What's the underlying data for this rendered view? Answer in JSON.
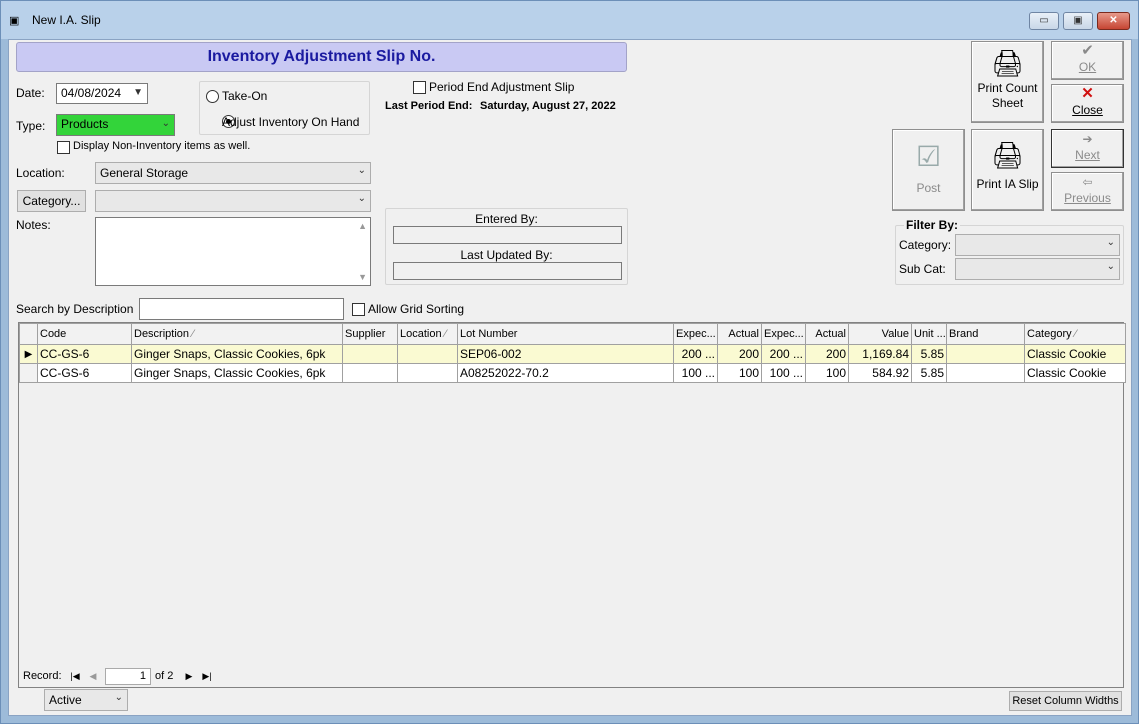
{
  "window": {
    "title": "New I.A. Slip",
    "min": "▭",
    "max": "▣",
    "close": "✕"
  },
  "header": {
    "title": "Inventory Adjustment Slip No."
  },
  "date": {
    "label": "Date:",
    "value": "04/08/2024"
  },
  "type": {
    "label": "Type:",
    "value": "Products",
    "color": "#33d43a"
  },
  "display_non_inventory": {
    "label": "Display Non-Inventory items as well."
  },
  "mode": {
    "take_on": "Take-On",
    "adjust": "Adjust Inventory On Hand",
    "selected": "adjust"
  },
  "period": {
    "checkbox_label": "Period End Adjustment Slip",
    "last_label": "Last Period End:",
    "last_value": "Saturday, August 27, 2022"
  },
  "location": {
    "label": "Location:",
    "value": "General Storage"
  },
  "category": {
    "button_label": "Category...",
    "value": ""
  },
  "notes": {
    "label": "Notes:",
    "value": ""
  },
  "audit": {
    "entered_label": "Entered By:",
    "entered_value": "",
    "updated_label": "Last Updated By:",
    "updated_value": ""
  },
  "buttons": {
    "print_count": "Print Count Sheet",
    "ok": "OK",
    "close": "Close",
    "post": "Post",
    "print_ia": "Print IA Slip",
    "next": "Next",
    "previous": "Previous"
  },
  "filter": {
    "title": "Filter By:",
    "category_label": "Category:",
    "subcat_label": "Sub Cat:"
  },
  "search": {
    "label": "Search by Description",
    "value": "",
    "allow_sorting": "Allow Grid Sorting"
  },
  "grid": {
    "columns": [
      "Code",
      "Description",
      "Supplier",
      "Location",
      "Lot Number",
      "Expec...",
      "Actual",
      "Expec...",
      "Actual",
      "Value",
      "Unit ...",
      "Brand",
      "Category"
    ],
    "rows": [
      [
        "CC-GS-6",
        "Ginger Snaps, Classic Cookies, 6pk",
        "",
        "",
        "SEP06-002",
        "200 ...",
        "200",
        "200 ...",
        "200",
        "1,169.84",
        "5.85",
        "",
        "Classic Cookie"
      ],
      [
        "CC-GS-6",
        "Ginger Snaps, Classic Cookies, 6pk",
        "",
        "",
        "A08252022-70.2",
        "100 ...",
        "100",
        "100 ...",
        "100",
        "584.92",
        "5.85",
        "",
        "Classic Cookie"
      ]
    ]
  },
  "nav": {
    "record_label": "Record:",
    "current": "1",
    "of": "of 2"
  },
  "status": {
    "value": "Active"
  },
  "reset_button": "Reset Column Widths"
}
